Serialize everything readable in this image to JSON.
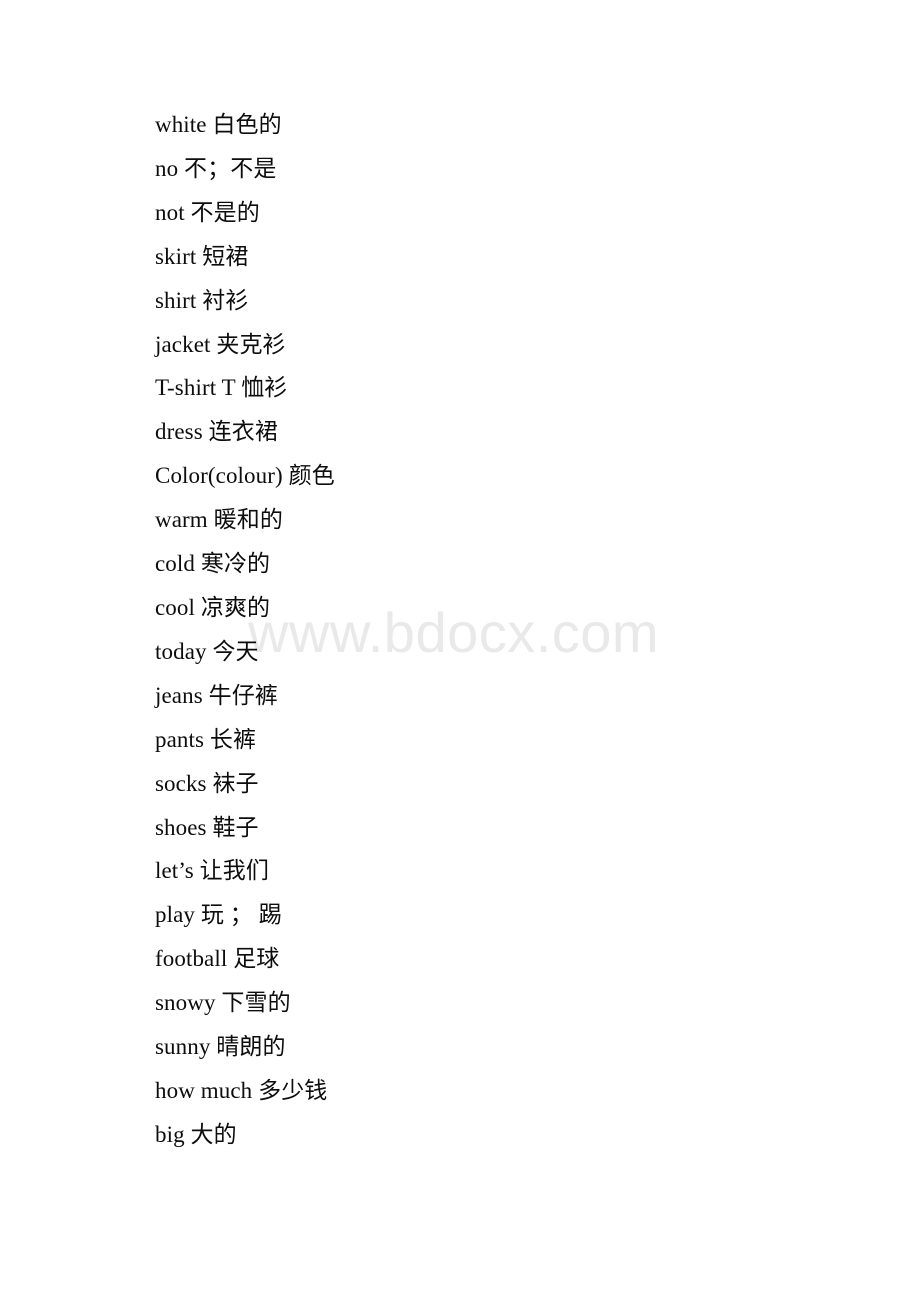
{
  "document": {
    "background_color": "#ffffff",
    "text_color": "#0d0d0d",
    "watermark": {
      "text": "www.bdocx.com",
      "color": "#e9e9e9"
    }
  },
  "vocabulary": {
    "lines": [
      {
        "term": "white",
        "gloss": "白色的",
        "text": "white 白色的"
      },
      {
        "term": "no",
        "gloss": "不；不是",
        "text": "no 不；不是"
      },
      {
        "term": "not",
        "gloss": "不是的",
        "text": "not 不是的"
      },
      {
        "term": "skirt",
        "gloss": "短裙",
        "text": "skirt 短裙"
      },
      {
        "term": "shirt",
        "gloss": "衬衫",
        "text": "shirt 衬衫"
      },
      {
        "term": "jacket",
        "gloss": "夹克衫",
        "text": "jacket 夹克衫"
      },
      {
        "term": "T-shirt",
        "gloss": "T 恤衫",
        "text": "T-shirt T 恤衫"
      },
      {
        "term": "dress",
        "gloss": "连衣裙",
        "text": "dress 连衣裙"
      },
      {
        "term": "Color(colour)",
        "gloss": "颜色",
        "text": "Color(colour) 颜色"
      },
      {
        "term": "warm",
        "gloss": "暖和的",
        "text": "warm 暖和的"
      },
      {
        "term": "cold",
        "gloss": "寒冷的",
        "text": "cold 寒冷的"
      },
      {
        "term": "cool",
        "gloss": "凉爽的",
        "text": "cool 凉爽的"
      },
      {
        "term": "today",
        "gloss": "今天",
        "text": "today 今天"
      },
      {
        "term": "jeans",
        "gloss": "牛仔裤",
        "text": "jeans 牛仔裤"
      },
      {
        "term": "pants",
        "gloss": "长裤",
        "text": "pants 长裤"
      },
      {
        "term": "socks",
        "gloss": "袜子",
        "text": "socks 袜子"
      },
      {
        "term": "shoes",
        "gloss": "鞋子",
        "text": "shoes 鞋子"
      },
      {
        "term": "let’s",
        "gloss": "让我们",
        "text": "let’s 让我们"
      },
      {
        "term": "play",
        "gloss": "玩 ； 踢",
        "text": "play 玩 ； 踢"
      },
      {
        "term": "football",
        "gloss": "足球",
        "text": "football 足球"
      },
      {
        "term": "snowy",
        "gloss": "下雪的",
        "text": "snowy 下雪的"
      },
      {
        "term": "sunny",
        "gloss": "晴朗的",
        "text": "sunny 晴朗的"
      },
      {
        "term": "how much",
        "gloss": "多少钱",
        "text": "how much 多少钱"
      },
      {
        "term": "big",
        "gloss": "大的",
        "text": "big 大的"
      }
    ]
  }
}
